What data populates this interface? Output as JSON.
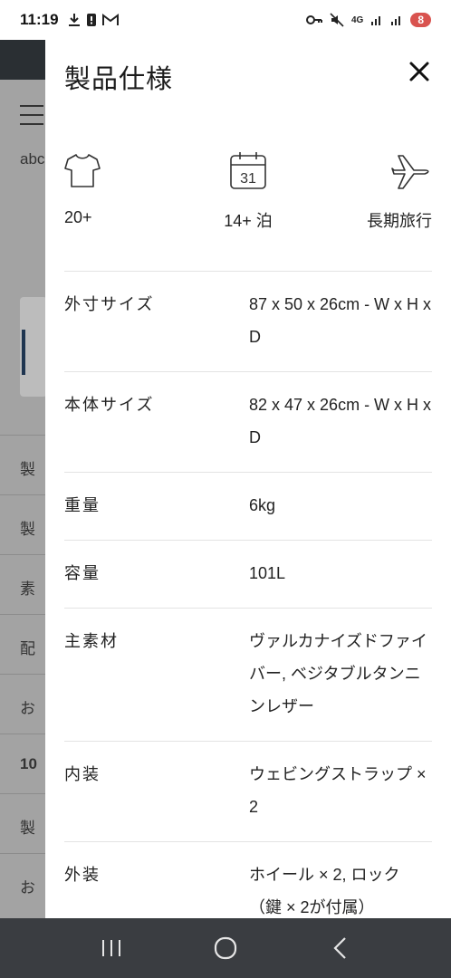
{
  "status_bar": {
    "time": "11:19",
    "network": "4G",
    "battery_badge": "8"
  },
  "background": {
    "items": [
      "abc",
      "製",
      "製",
      "素",
      "配",
      "お",
      "10",
      "製",
      "お"
    ]
  },
  "drawer": {
    "title": "製品仕様",
    "close_icon": "close-icon",
    "features": [
      {
        "icon": "tshirt-icon",
        "label": "20+"
      },
      {
        "icon": "calendar-icon",
        "label": "14+ 泊",
        "calendar_day": "31"
      },
      {
        "icon": "airplane-icon",
        "label": "長期旅行"
      }
    ],
    "specs": [
      {
        "key": "外寸サイズ",
        "value": "87 x 50 x 26cm - W x H x D"
      },
      {
        "key": "本体サイズ",
        "value": "82 x 47 x 26cm - W x H x D"
      },
      {
        "key": "重量",
        "value": "6kg"
      },
      {
        "key": "容量",
        "value": "101L"
      },
      {
        "key": "主素材",
        "value": "ヴァルカナイズドファイバー, ベジタブルタンニンレザー"
      },
      {
        "key": "内装",
        "value": "ウェビングストラップ × 2"
      },
      {
        "key": "外装",
        "value": "ホイール × 2, ロック（鍵 × 2が付属）"
      }
    ]
  },
  "nav": {
    "recents": "recents-icon",
    "home": "home-icon",
    "back": "back-icon"
  }
}
